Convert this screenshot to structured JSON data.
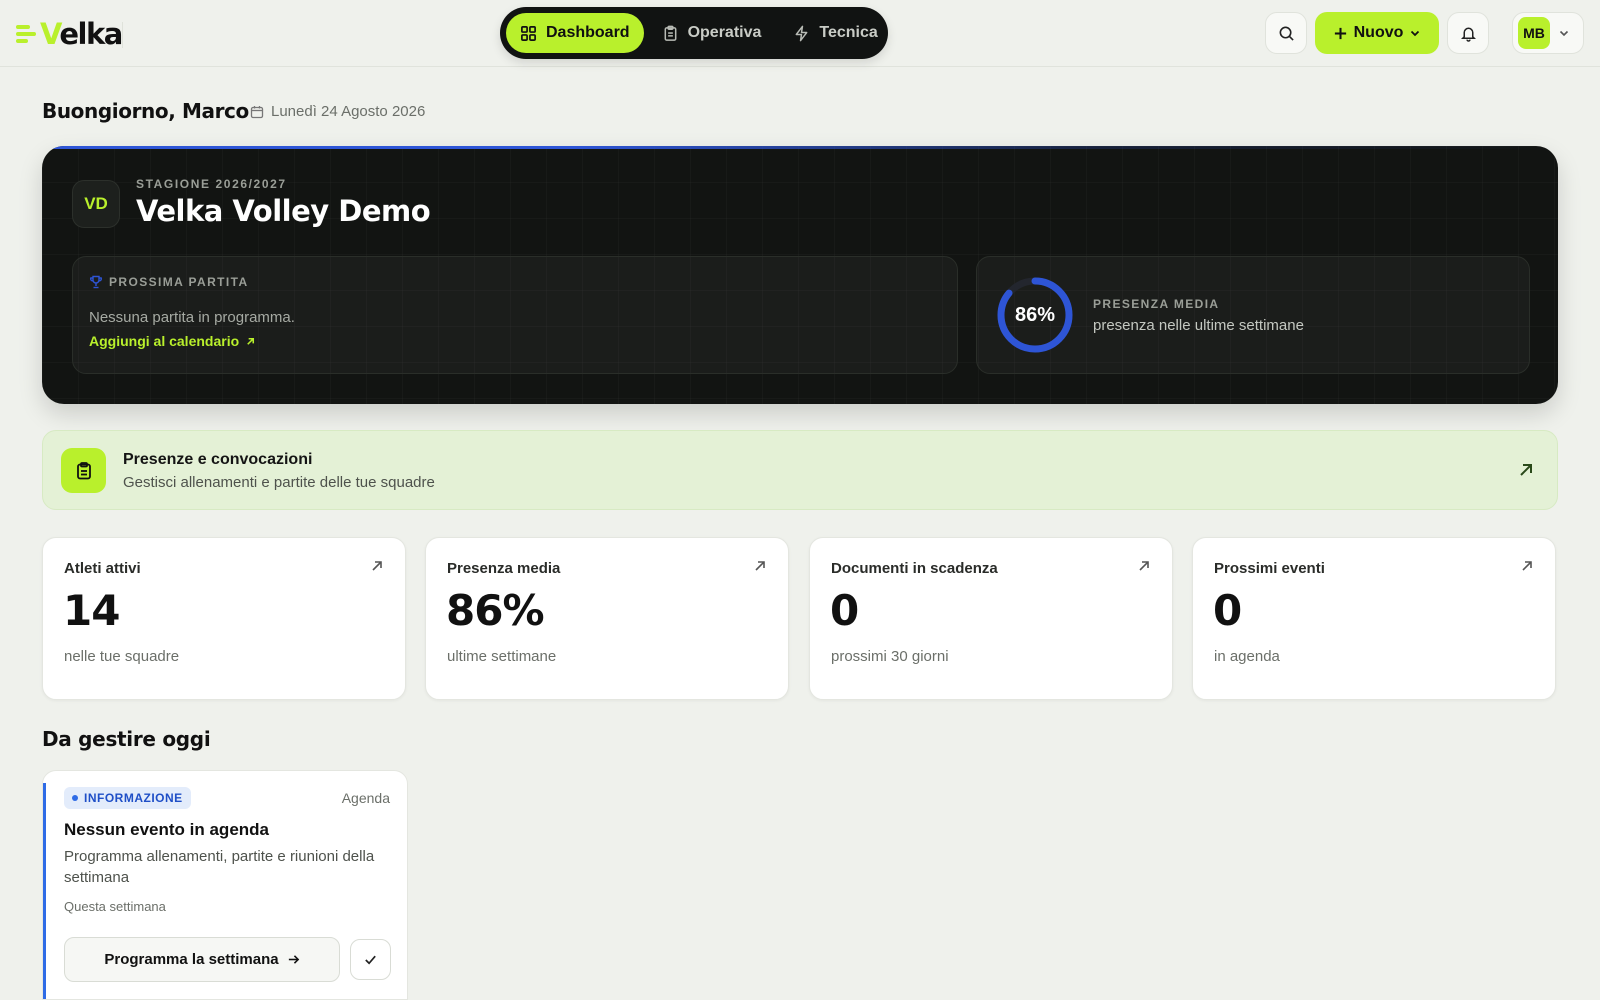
{
  "brand": {
    "name_prefix": "V",
    "name_rest": "elka",
    "accent": "#b9f02c"
  },
  "nav": {
    "items": [
      {
        "label": "Dashboard",
        "icon": "grid-icon",
        "active": true
      },
      {
        "label": "Operativa",
        "icon": "clipboard-icon",
        "active": false
      },
      {
        "label": "Tecnica",
        "icon": "bolt-icon",
        "active": false
      }
    ]
  },
  "header": {
    "new_label": "Nuovo",
    "user_initials": "MB"
  },
  "greeting": {
    "title": "Buongiorno, Marco",
    "date": "Lunedì 24 Agosto 2026"
  },
  "hero": {
    "badge": "VD",
    "season": "STAGIONE 2026/2027",
    "club": "Velka Volley Demo",
    "next_match": {
      "label": "PROSSIMA PARTITA",
      "text": "Nessuna partita in programma.",
      "link": "Aggiungi al calendario"
    },
    "attendance": {
      "value_text": "86%",
      "value": 0.86,
      "label": "PRESENZA MEDIA",
      "sub": "presenza nelle ultime settimane",
      "color": "#2e55d6"
    }
  },
  "banner": {
    "title": "Presenze e convocazioni",
    "sub": "Gestisci allenamenti e partite delle tue squadre"
  },
  "stats": [
    {
      "label": "Atleti attivi",
      "value": "14",
      "sub": "nelle tue squadre"
    },
    {
      "label": "Presenza media",
      "value": "86%",
      "sub": "ultime settimane"
    },
    {
      "label": "Documenti in scadenza",
      "value": "0",
      "sub": "prossimi 30 giorni"
    },
    {
      "label": "Prossimi eventi",
      "value": "0",
      "sub": "in agenda"
    }
  ],
  "today": {
    "title": "Da gestire oggi",
    "task": {
      "badge": "INFORMAZIONE",
      "tag": "Agenda",
      "title": "Nessun evento in agenda",
      "desc": "Programma allenamenti, partite e riunioni della settimana",
      "when": "Questa settimana",
      "action": "Programma la settimana"
    }
  }
}
